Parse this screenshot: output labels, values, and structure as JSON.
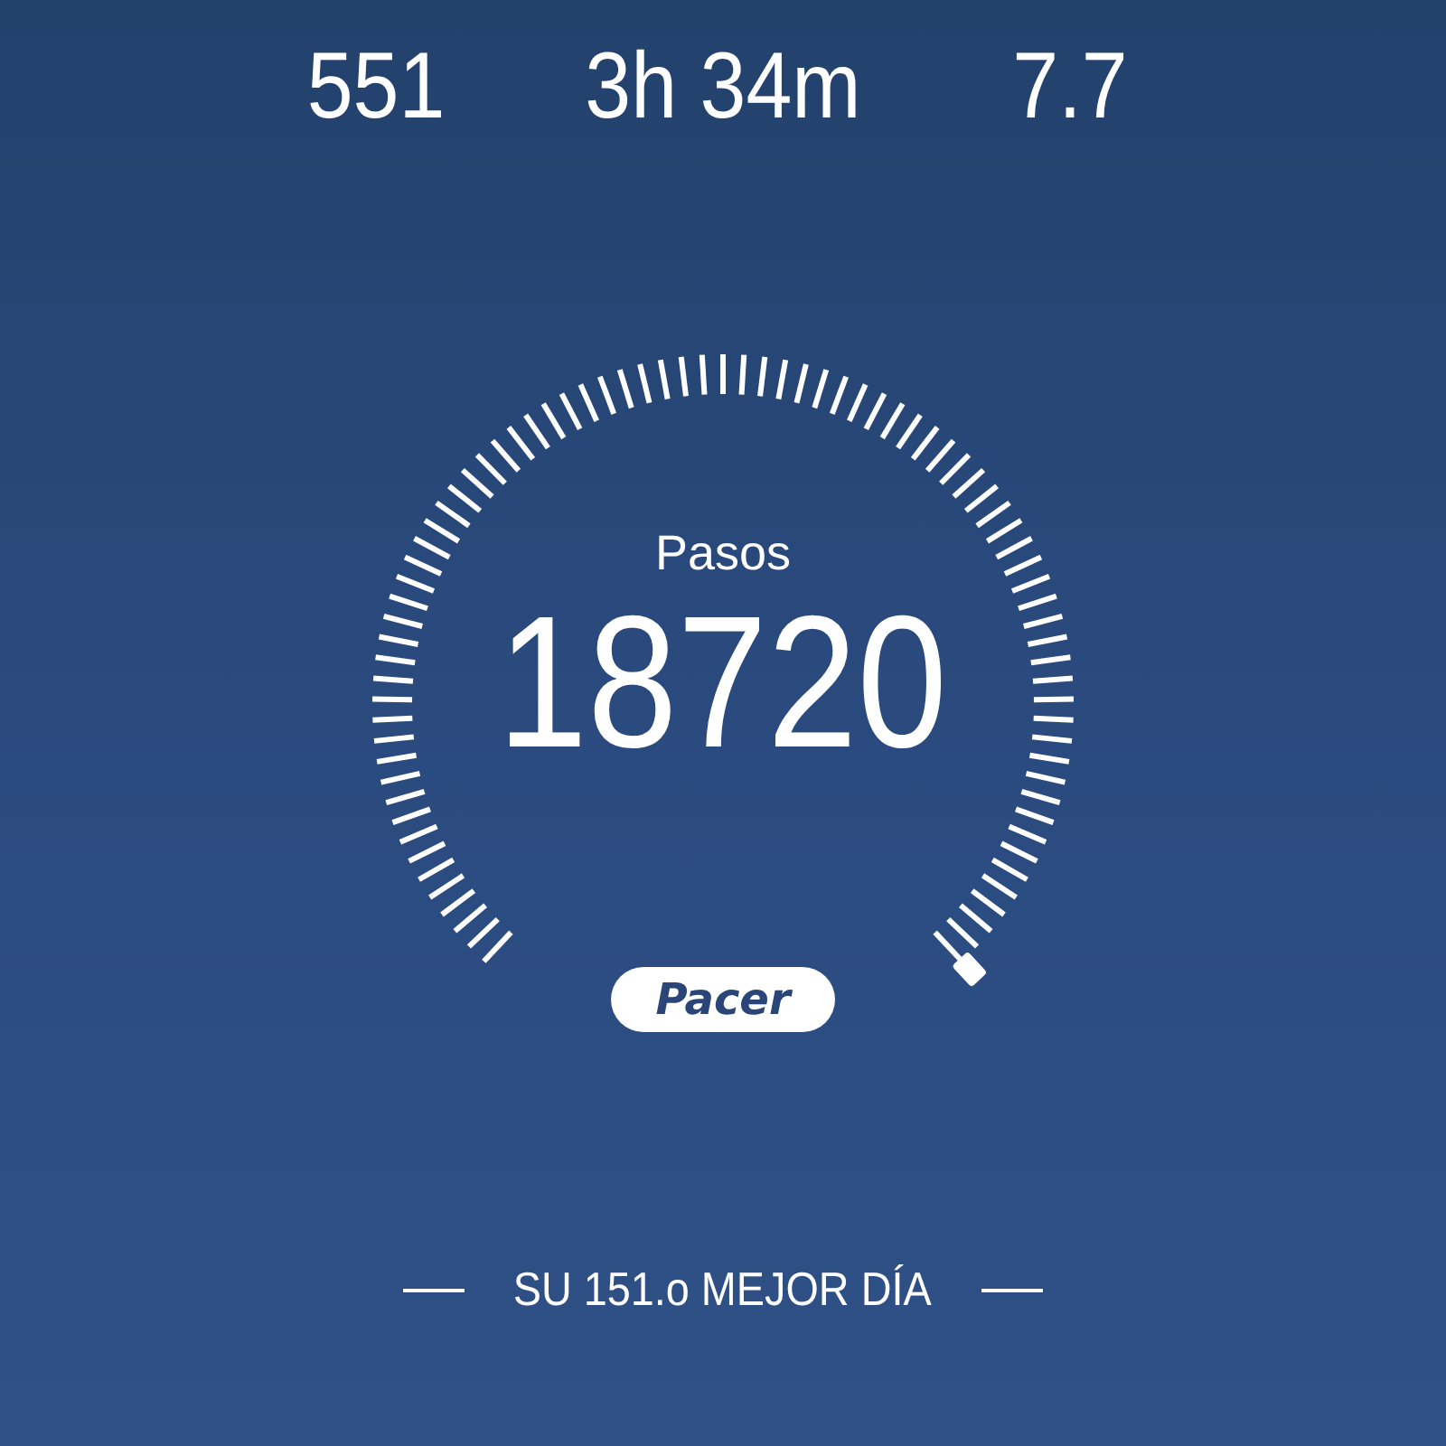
{
  "stats": [
    {
      "value": "551"
    },
    {
      "value": "3h 34m"
    },
    {
      "value": "7.7"
    }
  ],
  "gauge": {
    "label": "Pasos",
    "value": "18720"
  },
  "logo": "Pacer",
  "footer": "SU 151.o MEJOR DÍA"
}
